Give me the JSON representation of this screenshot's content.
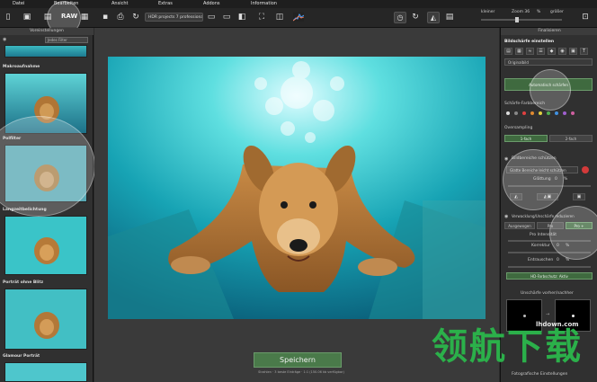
{
  "menu": [
    "Datei",
    "Bearbeiten",
    "Ansicht",
    "Extras",
    "Addons",
    "Information"
  ],
  "toolbar": {
    "raw_label": "RAW",
    "preset_select": "HDR projects 7 professional",
    "zoom_label": "Zoom 36",
    "zoom_unit": "%",
    "left_label": "kleiner",
    "right_label": "größer"
  },
  "left_panel": {
    "header": "Voreinstellungen",
    "filter_placeholder": "Jedes Filter",
    "presets": [
      {
        "label": "Makroaufnahme"
      },
      {
        "label": "Polfilter"
      },
      {
        "label": "Langzeitbelichtung"
      },
      {
        "label": "Porträt ohne Blitz"
      },
      {
        "label": "Glamour Porträt"
      }
    ]
  },
  "center": {
    "save_label": "Speichern",
    "status_text": "Strahlen · 3 beste Einträge · 1:1 (150.06 kb verfügbar)"
  },
  "right_panel": {
    "header": "Finalisieren",
    "section_title": "Bildschärfe einstellen",
    "original_select": "Originalbild",
    "auto_button": "Automatisch schärfen",
    "color_label": "Schärfe-Farbbereich",
    "oversampling_label": "Oversampling",
    "btn_1fach": "1-fach",
    "btn_2fach": "2-fach",
    "protect_label": "Bildbereiche schützen",
    "protect_select": "Glatte Bereiche leicht schützen",
    "smoothing_label": "Glättung",
    "smoothing_value": "0",
    "smoothing_unit": "%",
    "denoise_label": "Verwacklung/Unschärfe reduzieren",
    "btn_ausgewogen": "Ausgewogen",
    "btn_pro": "Pro",
    "btn_pro_plus": "Pro +",
    "pro_intensity": "Pro Intensität",
    "korrektur_label": "Korrektur",
    "korrektur_value": "0",
    "korrektur_unit": "%",
    "entrauschen_label": "Entrauschen",
    "entrauschen_value": "0",
    "entrauschen_unit": "%",
    "hd_button": "HD-Farbschutz: Aktiv",
    "compare_label": "Unschärfe vorher/nachher",
    "bottom_label": "Fotografische Einstellungen"
  },
  "swatches": [
    "#e04040",
    "#e08a30",
    "#e0d040",
    "#50b050",
    "#4090e0",
    "#a060d0",
    "#d060a0"
  ],
  "watermark": {
    "cn_text": "领航下载",
    "url": "lhdown.com"
  }
}
